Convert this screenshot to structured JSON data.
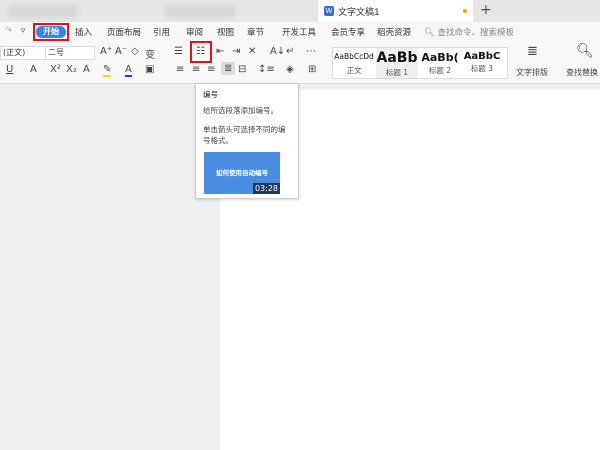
{
  "tabs": {
    "active_title": "文字文稿1",
    "new_tab": "+"
  },
  "menu": {
    "items": [
      "插入",
      "页面布局",
      "引用",
      "审阅",
      "视图",
      "章节",
      "开发工具",
      "会员专享",
      "稻壳资源"
    ],
    "start": "开始",
    "search_placeholder": "查找命令、搜索模板"
  },
  "ribbon": {
    "font_name": "(正文)",
    "font_size": "二号",
    "styles": [
      {
        "preview": "AaBbCcDd",
        "label": "正文"
      },
      {
        "preview": "AaBb",
        "label": "标题 1"
      },
      {
        "preview": "AaBb(",
        "label": "标题 2"
      },
      {
        "preview": "AaBbC",
        "label": "标题 3"
      }
    ],
    "text_layout": "文字排版",
    "find_replace": "查找替换"
  },
  "tooltip": {
    "title": "编号",
    "desc": "给所选段落添加编号。",
    "hint": "单击箭头可选择不同的编号格式。",
    "video_title": "如何使用自动编号",
    "video_duration": "03:28"
  },
  "colors": {
    "accent": "#3b82e8",
    "highlight_box": "#e0141e"
  }
}
